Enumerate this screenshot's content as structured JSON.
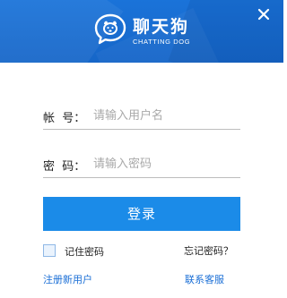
{
  "header": {
    "brand_name": "聊天狗",
    "brand_subtitle": "CHATTING DOG",
    "logo_icon": "chat-bubble-dog-icon",
    "close_icon": "close-icon",
    "background_color": "#1a73d9"
  },
  "form": {
    "account": {
      "label": "帐  号：",
      "placeholder": "请输入用户名",
      "value": ""
    },
    "password": {
      "label": "密  码：",
      "placeholder": "请输入密码",
      "value": ""
    },
    "login_button": "登录",
    "remember_label": "记住密码",
    "remember_checked": false,
    "forgot_label": "忘记密码？"
  },
  "footer": {
    "register_label": "注册新用户",
    "service_label": "联系客服"
  },
  "colors": {
    "accent": "#1b8be8",
    "link": "#1b6fd6"
  }
}
